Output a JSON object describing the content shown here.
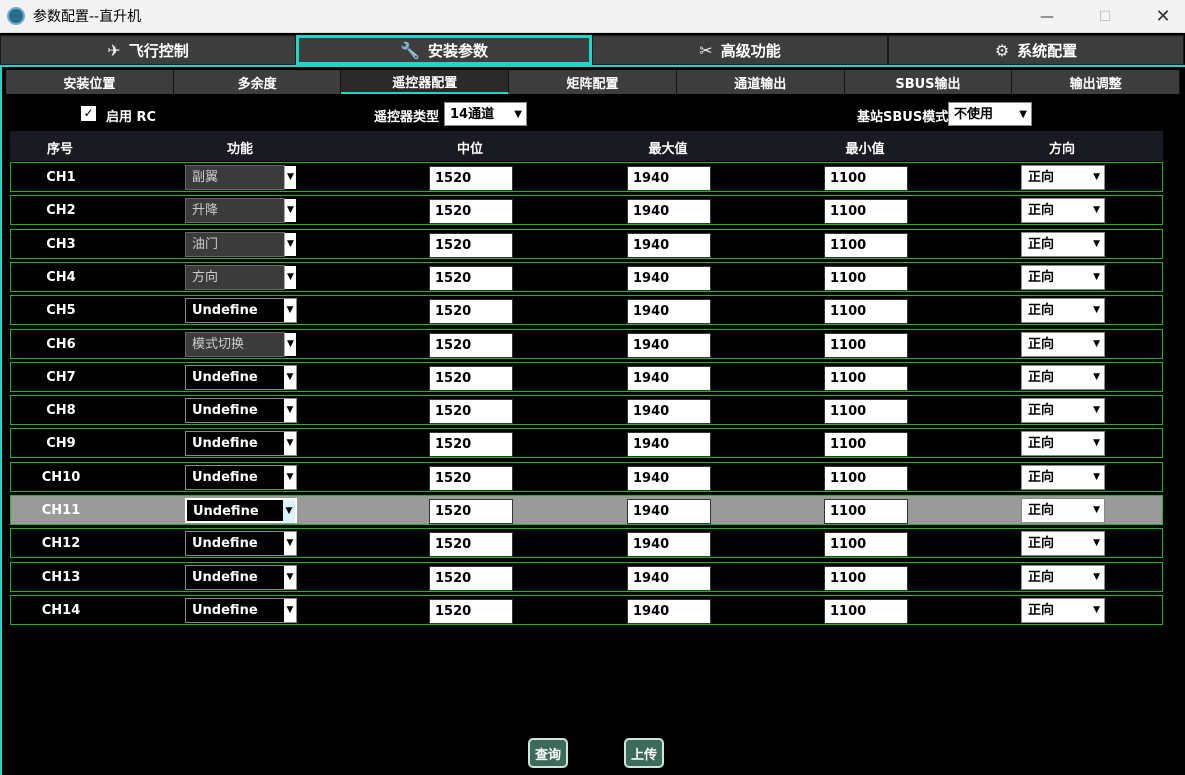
{
  "window": {
    "title": "参数配置--直升机",
    "minimize": "—",
    "maximize": "☐",
    "close": "✕"
  },
  "main_tabs": [
    {
      "label": "飞行控制",
      "icon": "✈"
    },
    {
      "label": "安装参数",
      "icon": "🔧"
    },
    {
      "label": "高级功能",
      "icon": "✂"
    },
    {
      "label": "系统配置",
      "icon": "⚙"
    }
  ],
  "sub_tabs": [
    "安装位置",
    "多余度",
    "遥控器配置",
    "矩阵配置",
    "通道输出",
    "SBUS输出",
    "输出调整"
  ],
  "options": {
    "enable_rc_label": "启用 RC",
    "enable_rc_checked": "✓",
    "rc_type_label": "遥控器类型",
    "rc_type_value": "14通道",
    "sbus_mode_label": "基站SBUS模式",
    "sbus_mode_value": "不使用"
  },
  "table": {
    "headers": [
      "序号",
      "功能",
      "中位",
      "最大值",
      "最小值",
      "方向"
    ],
    "rows": [
      {
        "ch": "CH1",
        "func": "副翼",
        "func_disabled": true,
        "mid": "1520",
        "max": "1940",
        "min": "1100",
        "dir": "正向"
      },
      {
        "ch": "CH2",
        "func": "升降",
        "func_disabled": true,
        "mid": "1520",
        "max": "1940",
        "min": "1100",
        "dir": "正向"
      },
      {
        "ch": "CH3",
        "func": "油门",
        "func_disabled": true,
        "mid": "1520",
        "max": "1940",
        "min": "1100",
        "dir": "正向"
      },
      {
        "ch": "CH4",
        "func": "方向",
        "func_disabled": true,
        "mid": "1520",
        "max": "1940",
        "min": "1100",
        "dir": "正向"
      },
      {
        "ch": "CH5",
        "func": "Undefine",
        "func_disabled": false,
        "mid": "1520",
        "max": "1940",
        "min": "1100",
        "dir": "正向"
      },
      {
        "ch": "CH6",
        "func": "模式切换",
        "func_disabled": true,
        "mid": "1520",
        "max": "1940",
        "min": "1100",
        "dir": "正向"
      },
      {
        "ch": "CH7",
        "func": "Undefine",
        "func_disabled": false,
        "mid": "1520",
        "max": "1940",
        "min": "1100",
        "dir": "正向"
      },
      {
        "ch": "CH8",
        "func": "Undefine",
        "func_disabled": false,
        "mid": "1520",
        "max": "1940",
        "min": "1100",
        "dir": "正向"
      },
      {
        "ch": "CH9",
        "func": "Undefine",
        "func_disabled": false,
        "mid": "1520",
        "max": "1940",
        "min": "1100",
        "dir": "正向"
      },
      {
        "ch": "CH10",
        "func": "Undefine",
        "func_disabled": false,
        "mid": "1520",
        "max": "1940",
        "min": "1100",
        "dir": "正向"
      },
      {
        "ch": "CH11",
        "func": "Undefine",
        "func_disabled": false,
        "mid": "1520",
        "max": "1940",
        "min": "1100",
        "dir": "正向",
        "selected": true
      },
      {
        "ch": "CH12",
        "func": "Undefine",
        "func_disabled": false,
        "mid": "1520",
        "max": "1940",
        "min": "1100",
        "dir": "正向"
      },
      {
        "ch": "CH13",
        "func": "Undefine",
        "func_disabled": false,
        "mid": "1520",
        "max": "1940",
        "min": "1100",
        "dir": "正向"
      },
      {
        "ch": "CH14",
        "func": "Undefine",
        "func_disabled": false,
        "mid": "1520",
        "max": "1940",
        "min": "1100",
        "dir": "正向"
      }
    ]
  },
  "buttons": {
    "query": "查询",
    "upload": "上传"
  },
  "colors": {
    "accent": "#1fd6c8",
    "row_border": "#1eb81e",
    "button_bg": "#3d6b5b"
  }
}
